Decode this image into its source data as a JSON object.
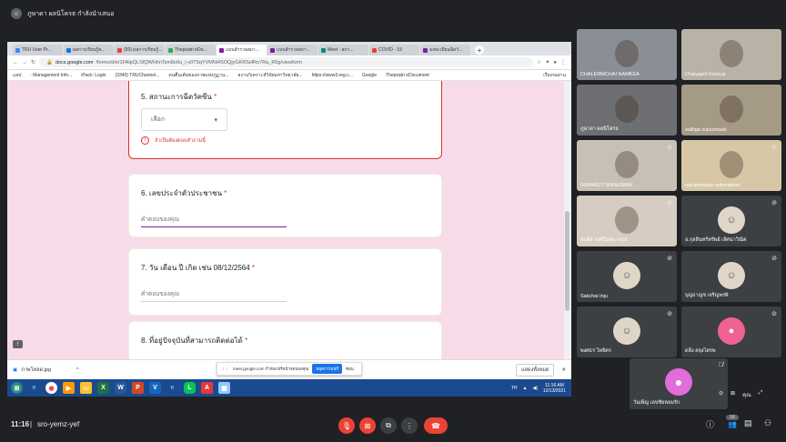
{
  "presenter": {
    "name": "ภูษาดา ผลนิโครธ กำลังนำเสนอ"
  },
  "browser": {
    "tabs": [
      {
        "label": "TRU User Pr...",
        "color": "#4285f4"
      },
      {
        "label": "ผลการเรียนรู้ส...",
        "color": "#1a73e8"
      },
      {
        "label": "(50) ผลการเรียนรู้...",
        "color": "#ea4335"
      },
      {
        "label": "Thepsatri eDo...",
        "color": "#34a853"
      },
      {
        "label": "แบบสำรวจสถา...",
        "color": "#7b1fa2"
      },
      {
        "label": "แบบสำรวจสถา...",
        "color": "#7b1fa2"
      },
      {
        "label": "Meet - สถา...",
        "color": "#00897b"
      },
      {
        "label": "COVID - 19",
        "color": "#ea4335"
      },
      {
        "label": "ลงทะเบียนฉีดวั...",
        "color": "#7b1fa2"
      }
    ],
    "url_host": "docs.google.com",
    "url_path": "/forms/d/e/1FAIpQLSfQWHImTsm8o0u_i-v07SqYVMNi4SOQjyGKRSxfRo7Ra_R5g/viewform",
    "bookmarks": [
      "แอป",
      ": Management Info...",
      "iPack: Login",
      "(3340) TRUChannel...",
      "คนตื่นเต้นของภาพแห่งภูฏาน...",
      "ลงานวิเคราะห์วิจัยมหาวิทยาลัย...",
      "https://www3.reg.c...",
      "Google",
      "Thepsatri eDocument"
    ],
    "reading_list": "เรื่องรออ่าน"
  },
  "form": {
    "q5": {
      "label": "5. สถานะการฉีดวัคซีน",
      "req": "*",
      "dropdown": "เลือก",
      "error": "จำเป็นต้องตอบคำถามนี้"
    },
    "q6": {
      "label": "6. เลขประจำตัวประชาชน",
      "req": "*",
      "placeholder": "คำตอบของคุณ"
    },
    "q7": {
      "label": "7. วัน เดือน ปี เกิด เช่น 08/12/2564",
      "req": "*",
      "placeholder": "คำตอบของคุณ"
    },
    "q8": {
      "label": "8. ที่อยู่ปัจจุบันที่สามารถติดต่อได้",
      "req": "*"
    }
  },
  "download": {
    "file": "ภาพโหลด.jpg",
    "show_all": "แสดงทั้งหมด"
  },
  "share_notice": {
    "text": "meet.google.com กำลังแชร์หน้าจอของคุณ",
    "stop": "หยุดการแชร์",
    "hide": "ซ่อน"
  },
  "taskbar": {
    "lang": "TH",
    "time": "11:16 AM",
    "date": "12/13/2021"
  },
  "participants": [
    {
      "name": "CHALERMCHAI NAMKEA",
      "muted": false,
      "style": "video"
    },
    {
      "name": "Chaiyapol Koosup",
      "muted": false,
      "style": "video"
    },
    {
      "name": "ภูษาดา ผลนิโครธ",
      "muted": false,
      "style": "video"
    },
    {
      "name": "walliga suksomsak",
      "muted": false,
      "style": "video"
    },
    {
      "name": "SUPARUT SINSUWAN",
      "muted": true,
      "style": "video"
    },
    {
      "name": "narumonwan sukmaitree",
      "muted": true,
      "style": "video"
    },
    {
      "name": "สมจิต วงศ์วิมลนาจกุล",
      "muted": true,
      "style": "video"
    },
    {
      "name": "อ.กุลสินทร์ทรัพย์ เลิศนาวิณิต",
      "muted": true,
      "style": "photo"
    },
    {
      "name": "Sakchai Inju",
      "muted": true,
      "style": "photo"
    },
    {
      "name": "บุญธาญช เจริญพรพิ",
      "muted": true,
      "style": "photo"
    },
    {
      "name": "พงศธร ไพจิตร",
      "muted": true,
      "style": "photo"
    },
    {
      "name": "ดลิ่ง สลุงไตรพ",
      "muted": true,
      "style": "avatar"
    }
  ],
  "self_tile": {
    "name": "วันเพ็ญ เลปชัยหอมรัก",
    "you_label": "คุณ"
  },
  "meeting": {
    "time": "11:16",
    "code": "sro-yemz-yef",
    "participant_count": "16"
  }
}
